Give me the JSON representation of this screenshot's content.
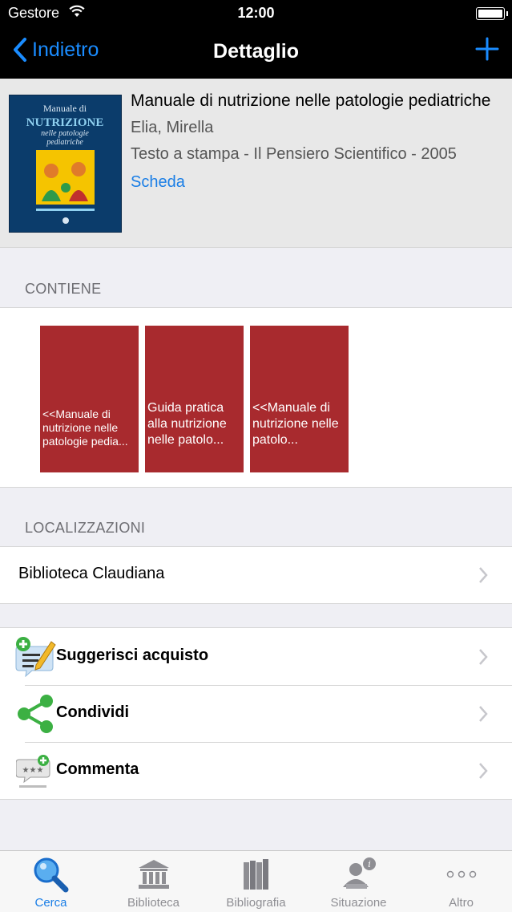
{
  "status": {
    "carrier": "Gestore",
    "time": "12:00"
  },
  "nav": {
    "back_label": "Indietro",
    "title": "Dettaglio"
  },
  "book": {
    "title": "Manuale di nutrizione nelle patologie pediatriche",
    "author": "Elia, Mirella",
    "publication": "Testo a stampa - Il Pensiero Scientifico - 2005",
    "link": "Scheda",
    "cover": {
      "line1": "Manuale di",
      "line2": "NUTRIZIONE",
      "line3": "nelle patologie",
      "line4": "pediatriche",
      "colors": {
        "bg": "#0b3c6b",
        "accent": "#f5c400",
        "green": "#2e9a4a"
      }
    }
  },
  "contiene": {
    "heading": "CONTIENE",
    "items": [
      {
        "text": "<<Manuale di nutrizione nelle patologie pedia..."
      },
      {
        "text": "Guida pratica alla nutrizione nelle patolo..."
      },
      {
        "text": "<<Manuale di nutrizione nelle patolo..."
      }
    ]
  },
  "localizzazioni": {
    "heading": "LOCALIZZAZIONI",
    "items": [
      {
        "label": "Biblioteca Claudiana"
      }
    ]
  },
  "actions": [
    {
      "label": "Suggerisci acquisto",
      "icon": "suggest-purchase-icon"
    },
    {
      "label": "Condividi",
      "icon": "share-icon"
    },
    {
      "label": "Commenta",
      "icon": "comment-icon"
    }
  ],
  "tabs": [
    {
      "label": "Cerca",
      "icon": "search-icon",
      "active": true
    },
    {
      "label": "Biblioteca",
      "icon": "library-icon"
    },
    {
      "label": "Bibliografia",
      "icon": "books-icon"
    },
    {
      "label": "Situazione",
      "icon": "user-status-icon"
    },
    {
      "label": "Altro",
      "icon": "more-icon"
    }
  ],
  "colors": {
    "accent": "#1a7ee6",
    "tile": "#a82a2e",
    "navbar": "#000000"
  }
}
